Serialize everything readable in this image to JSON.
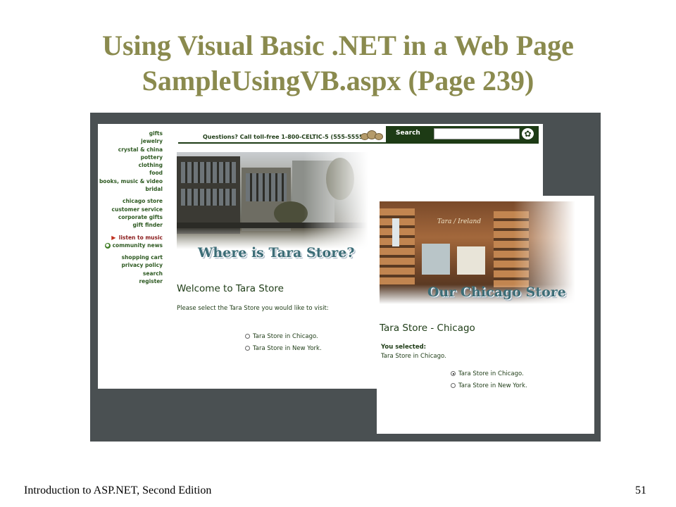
{
  "slide": {
    "title_line1": "Using Visual Basic .NET in a Web Page",
    "title_line2": "SampleUsingVB.aspx (Page 239)",
    "footer_left": "Introduction to ASP.NET, Second Edition",
    "page_number": "51",
    "title_color": "#8a8a4e"
  },
  "store_page": {
    "nav": {
      "categories": [
        "gifts",
        "jewelry",
        "crystal & china",
        "pottery",
        "clothing",
        "food",
        "books, music & video",
        "bridal"
      ],
      "services": [
        "chicago store",
        "customer service",
        "corporate gifts",
        "gift finder"
      ],
      "media": [
        {
          "label": "listen to music",
          "icon": "speaker-icon"
        },
        {
          "label": "community news",
          "icon": "community-icon"
        }
      ],
      "utility": [
        "shopping cart",
        "privacy policy",
        "search",
        "register"
      ]
    },
    "topbar": {
      "questions": "Questions? Call toll-free 1-800-CELTIC-5 (555-5555)",
      "search_label": "Search",
      "search_value": "",
      "go_icon": "shamrock-go-icon"
    },
    "banner": "Where is Tara Store?",
    "welcome": "Welcome to Tara Store",
    "prompt": "Please select the Tara Store you would like to visit:",
    "options": [
      {
        "label": "Tara Store in Chicago.",
        "selected": false
      },
      {
        "label": "Tara Store in New York.",
        "selected": false
      }
    ]
  },
  "result_page": {
    "banner": "Our Chicago Store",
    "photo_sign": "Tara / Ireland",
    "title": "Tara Store - Chicago",
    "you_selected_label": "You selected:",
    "you_selected_value": "Tara Store in Chicago.",
    "options": [
      {
        "label": "Tara Store in Chicago.",
        "selected": true
      },
      {
        "label": "Tara Store in New York.",
        "selected": false
      }
    ]
  },
  "colors": {
    "brand_green": "#1d3b15",
    "nav_green": "#2e5a22",
    "banner_teal": "#3c6d77",
    "backdrop": "#4a5052"
  }
}
